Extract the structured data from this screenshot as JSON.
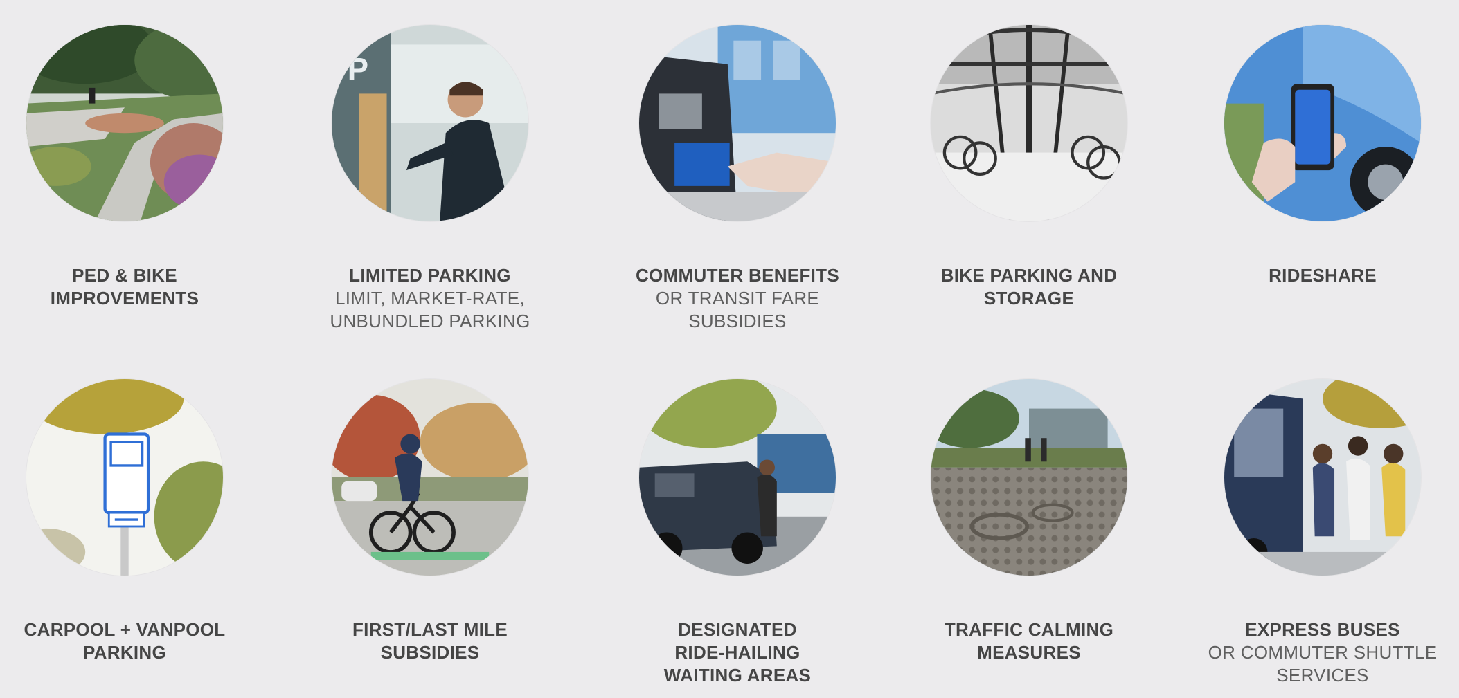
{
  "items": [
    {
      "title": "PED & BIKE",
      "title2": "IMPROVEMENTS",
      "sub1": "",
      "sub2": "",
      "photo_icon": "walkway-photo"
    },
    {
      "title": "LIMITED PARKING",
      "title2": "",
      "sub1": "LIMIT, MARKET-RATE,",
      "sub2": "UNBUNDLED PARKING",
      "photo_icon": "parking-meter-photo"
    },
    {
      "title": "COMMUTER BENEFITS",
      "title2": "",
      "sub1": "OR TRANSIT FARE",
      "sub2": "SUBSIDIES",
      "photo_icon": "fare-card-photo"
    },
    {
      "title": "BIKE PARKING AND",
      "title2": "STORAGE",
      "sub1": "",
      "sub2": "",
      "photo_icon": "bike-shelter-photo"
    },
    {
      "title": "RIDESHARE",
      "title2": "",
      "sub1": "",
      "sub2": "",
      "photo_icon": "phone-app-photo"
    },
    {
      "title": "CARPOOL + VANPOOL",
      "title2": "PARKING",
      "sub1": "",
      "sub2": "",
      "photo_icon": "carpool-sign-photo"
    },
    {
      "title": "FIRST/LAST MILE",
      "title2": "SUBSIDIES",
      "sub1": "",
      "sub2": "",
      "photo_icon": "cyclist-photo"
    },
    {
      "title": "DESIGNATED",
      "title2": "RIDE-HAILING",
      "title3": "WAITING AREAS",
      "sub1": "",
      "sub2": "",
      "photo_icon": "ride-hailing-photo"
    },
    {
      "title": "TRAFFIC CALMING",
      "title2": "MEASURES",
      "sub1": "",
      "sub2": "",
      "photo_icon": "paved-plaza-photo"
    },
    {
      "title": "EXPRESS BUSES",
      "title2": "",
      "sub1": "OR COMMUTER SHUTTLE",
      "sub2": "SERVICES",
      "photo_icon": "shuttle-bus-photo"
    }
  ],
  "colors": {
    "background": "#ecebed",
    "title_text": "#454545",
    "subtitle_text": "#5f5f5f",
    "accent_blue": "#2f6fd6"
  }
}
